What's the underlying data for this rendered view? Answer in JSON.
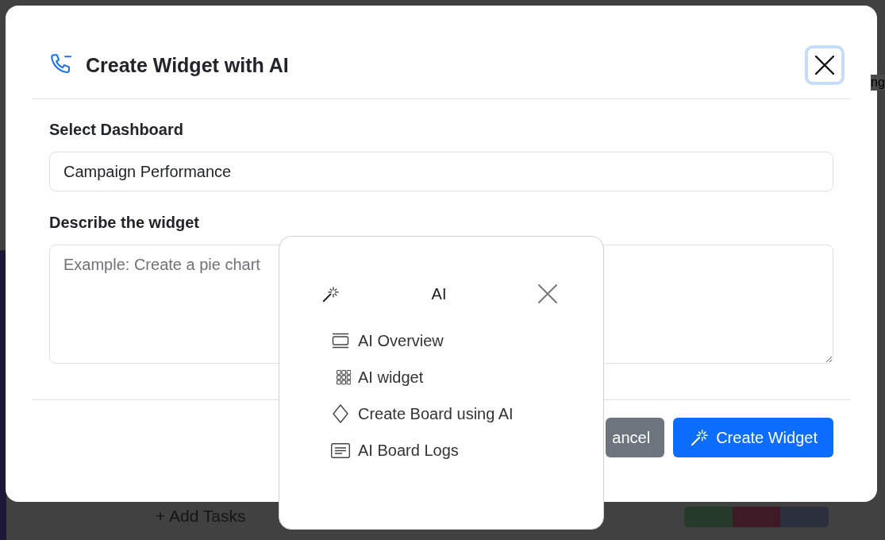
{
  "background": {
    "add_tasks_label": "+ Add Tasks",
    "edge_text": "ng",
    "status_segments": [
      {
        "color": "#263a2a"
      },
      {
        "color": "#3d1a26"
      },
      {
        "color": "#2c2f3d"
      }
    ]
  },
  "dialog": {
    "title": "Create Widget with AI",
    "close_focused": true,
    "fields": [
      {
        "kind": "input",
        "label": "Select Dashboard",
        "value": "Campaign Performance"
      },
      {
        "kind": "textarea",
        "label": "Describe the widget",
        "placeholder": "Example: Create a pie chart"
      }
    ],
    "buttons": [
      {
        "kind": "secondary",
        "label": "ancel"
      },
      {
        "kind": "primary",
        "label": "Create Widget"
      }
    ]
  },
  "ai_menu": {
    "title": "AI",
    "items": [
      {
        "label": "AI Overview"
      },
      {
        "label": "AI widget"
      },
      {
        "label": "Create Board using AI"
      },
      {
        "label": "AI Board Logs"
      }
    ]
  }
}
